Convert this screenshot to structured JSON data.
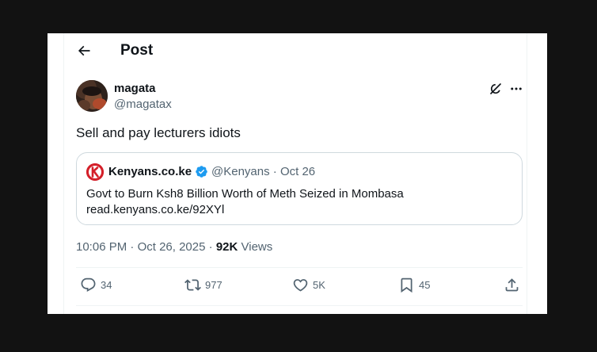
{
  "header": {
    "title": "Post"
  },
  "post": {
    "display_name": "magata",
    "handle": "@magatax",
    "text": "Sell and pay lecturers idiots",
    "time": "10:06 PM",
    "separator": "·",
    "date": "Oct 26, 2025",
    "views_count": "92K",
    "views_label": "Views"
  },
  "quote": {
    "name": "Kenyans.co.ke",
    "handle": "@Kenyans",
    "separator": "·",
    "date": "Oct 26",
    "headline": "Govt to Burn Ksh8 Billion Worth of Meth Seized in Mombasa",
    "link": "read.kenyans.co.ke/92XYl",
    "logo_letter": "K"
  },
  "actions": {
    "replies": "34",
    "reposts": "977",
    "likes": "5K",
    "bookmarks": "45"
  },
  "icons": {
    "back": "arrow-left-icon",
    "grok": "grok-icon",
    "more": "more-horizontal-icon",
    "verified": "verified-badge-icon",
    "reply": "reply-icon",
    "repost": "repost-icon",
    "like": "heart-icon",
    "bookmark": "bookmark-icon",
    "share": "share-icon"
  },
  "colors": {
    "text_primary": "#0f1419",
    "text_secondary": "#536471",
    "border": "#cfd9de",
    "verified_blue": "#1d9bf0",
    "kenyans_red": "#d4202a",
    "outer_background": "#121212"
  }
}
